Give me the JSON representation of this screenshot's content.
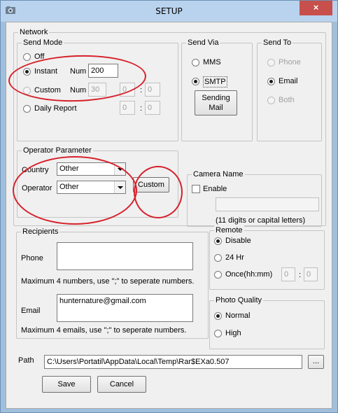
{
  "window": {
    "title": "SETUP",
    "close_glyph": "×",
    "accent": "#c7504c"
  },
  "network": {
    "legend": "Network",
    "send_mode": {
      "legend": "Send Mode",
      "off_label": "Off",
      "instant_label": "Instant",
      "instant_num_label": "Num",
      "instant_num_value": "200",
      "custom_label": "Custom",
      "custom_num_label": "Num",
      "custom_num_value": "30",
      "custom_hour": "0",
      "custom_minute": "0",
      "daily_label": "Daily Report",
      "daily_hour": "0",
      "daily_minute": "0",
      "colon": ":"
    },
    "send_via": {
      "legend": "Send Via",
      "mms_label": "MMS",
      "smtp_label": "SMTP",
      "sending_mail_line1": "Sending",
      "sending_mail_line2": "Mail"
    },
    "send_to": {
      "legend": "Send To",
      "phone_label": "Phone",
      "email_label": "Email",
      "both_label": "Both"
    },
    "operator_parameter": {
      "legend": "Operator Parameter",
      "country_label": "Country",
      "country_value": "Other",
      "operator_label": "Operator",
      "operator_value": "Other",
      "custom_button": "Custom"
    },
    "camera_name": {
      "legend": "Camera Name",
      "enable_label": "Enable",
      "name_value": "",
      "hint": "(11 digits or capital letters)"
    }
  },
  "recipients": {
    "legend": "Recipients",
    "phone_label": "Phone",
    "phone_value": "",
    "phone_hint": "Maximum 4 numbers, use \";\" to seperate numbers.",
    "email_label": "Email",
    "email_value": "hunternature@gmail.com",
    "email_hint": "Maximum 4 emails, use \";\" to seperate numbers."
  },
  "remote": {
    "legend": "Remote",
    "disable_label": "Disable",
    "hr24_label": "24 Hr",
    "once_label": "Once(hh:mm)",
    "once_hour": "0",
    "once_minute": "0",
    "colon": ":"
  },
  "photo_quality": {
    "legend": "Photo Quality",
    "normal_label": "Normal",
    "high_label": "High"
  },
  "path": {
    "label": "Path",
    "value": "C:\\Users\\Portatil\\AppData\\Local\\Temp\\Rar$EXa0.507",
    "browse_label": "..."
  },
  "actions": {
    "save_label": "Save",
    "cancel_label": "Cancel"
  },
  "annotations": {
    "color": "#d6202a"
  }
}
